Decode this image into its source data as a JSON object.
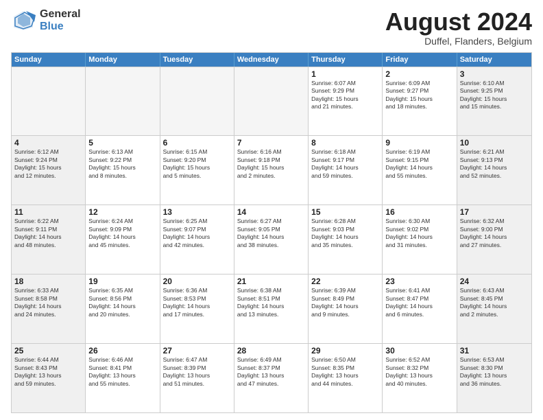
{
  "header": {
    "logo_general": "General",
    "logo_blue": "Blue",
    "month_title": "August 2024",
    "location": "Duffel, Flanders, Belgium"
  },
  "days_of_week": [
    "Sunday",
    "Monday",
    "Tuesday",
    "Wednesday",
    "Thursday",
    "Friday",
    "Saturday"
  ],
  "weeks": [
    [
      {
        "day": "",
        "text": "",
        "empty": true
      },
      {
        "day": "",
        "text": "",
        "empty": true
      },
      {
        "day": "",
        "text": "",
        "empty": true
      },
      {
        "day": "",
        "text": "",
        "empty": true
      },
      {
        "day": "1",
        "text": "Sunrise: 6:07 AM\nSunset: 9:29 PM\nDaylight: 15 hours\nand 21 minutes."
      },
      {
        "day": "2",
        "text": "Sunrise: 6:09 AM\nSunset: 9:27 PM\nDaylight: 15 hours\nand 18 minutes."
      },
      {
        "day": "3",
        "text": "Sunrise: 6:10 AM\nSunset: 9:25 PM\nDaylight: 15 hours\nand 15 minutes.",
        "shade": true
      }
    ],
    [
      {
        "day": "4",
        "text": "Sunrise: 6:12 AM\nSunset: 9:24 PM\nDaylight: 15 hours\nand 12 minutes.",
        "shade": true
      },
      {
        "day": "5",
        "text": "Sunrise: 6:13 AM\nSunset: 9:22 PM\nDaylight: 15 hours\nand 8 minutes."
      },
      {
        "day": "6",
        "text": "Sunrise: 6:15 AM\nSunset: 9:20 PM\nDaylight: 15 hours\nand 5 minutes."
      },
      {
        "day": "7",
        "text": "Sunrise: 6:16 AM\nSunset: 9:18 PM\nDaylight: 15 hours\nand 2 minutes."
      },
      {
        "day": "8",
        "text": "Sunrise: 6:18 AM\nSunset: 9:17 PM\nDaylight: 14 hours\nand 59 minutes."
      },
      {
        "day": "9",
        "text": "Sunrise: 6:19 AM\nSunset: 9:15 PM\nDaylight: 14 hours\nand 55 minutes."
      },
      {
        "day": "10",
        "text": "Sunrise: 6:21 AM\nSunset: 9:13 PM\nDaylight: 14 hours\nand 52 minutes.",
        "shade": true
      }
    ],
    [
      {
        "day": "11",
        "text": "Sunrise: 6:22 AM\nSunset: 9:11 PM\nDaylight: 14 hours\nand 48 minutes.",
        "shade": true
      },
      {
        "day": "12",
        "text": "Sunrise: 6:24 AM\nSunset: 9:09 PM\nDaylight: 14 hours\nand 45 minutes."
      },
      {
        "day": "13",
        "text": "Sunrise: 6:25 AM\nSunset: 9:07 PM\nDaylight: 14 hours\nand 42 minutes."
      },
      {
        "day": "14",
        "text": "Sunrise: 6:27 AM\nSunset: 9:05 PM\nDaylight: 14 hours\nand 38 minutes."
      },
      {
        "day": "15",
        "text": "Sunrise: 6:28 AM\nSunset: 9:03 PM\nDaylight: 14 hours\nand 35 minutes."
      },
      {
        "day": "16",
        "text": "Sunrise: 6:30 AM\nSunset: 9:02 PM\nDaylight: 14 hours\nand 31 minutes."
      },
      {
        "day": "17",
        "text": "Sunrise: 6:32 AM\nSunset: 9:00 PM\nDaylight: 14 hours\nand 27 minutes.",
        "shade": true
      }
    ],
    [
      {
        "day": "18",
        "text": "Sunrise: 6:33 AM\nSunset: 8:58 PM\nDaylight: 14 hours\nand 24 minutes.",
        "shade": true
      },
      {
        "day": "19",
        "text": "Sunrise: 6:35 AM\nSunset: 8:56 PM\nDaylight: 14 hours\nand 20 minutes."
      },
      {
        "day": "20",
        "text": "Sunrise: 6:36 AM\nSunset: 8:53 PM\nDaylight: 14 hours\nand 17 minutes."
      },
      {
        "day": "21",
        "text": "Sunrise: 6:38 AM\nSunset: 8:51 PM\nDaylight: 14 hours\nand 13 minutes."
      },
      {
        "day": "22",
        "text": "Sunrise: 6:39 AM\nSunset: 8:49 PM\nDaylight: 14 hours\nand 9 minutes."
      },
      {
        "day": "23",
        "text": "Sunrise: 6:41 AM\nSunset: 8:47 PM\nDaylight: 14 hours\nand 6 minutes."
      },
      {
        "day": "24",
        "text": "Sunrise: 6:43 AM\nSunset: 8:45 PM\nDaylight: 14 hours\nand 2 minutes.",
        "shade": true
      }
    ],
    [
      {
        "day": "25",
        "text": "Sunrise: 6:44 AM\nSunset: 8:43 PM\nDaylight: 13 hours\nand 59 minutes.",
        "shade": true
      },
      {
        "day": "26",
        "text": "Sunrise: 6:46 AM\nSunset: 8:41 PM\nDaylight: 13 hours\nand 55 minutes."
      },
      {
        "day": "27",
        "text": "Sunrise: 6:47 AM\nSunset: 8:39 PM\nDaylight: 13 hours\nand 51 minutes."
      },
      {
        "day": "28",
        "text": "Sunrise: 6:49 AM\nSunset: 8:37 PM\nDaylight: 13 hours\nand 47 minutes."
      },
      {
        "day": "29",
        "text": "Sunrise: 6:50 AM\nSunset: 8:35 PM\nDaylight: 13 hours\nand 44 minutes."
      },
      {
        "day": "30",
        "text": "Sunrise: 6:52 AM\nSunset: 8:32 PM\nDaylight: 13 hours\nand 40 minutes."
      },
      {
        "day": "31",
        "text": "Sunrise: 6:53 AM\nSunset: 8:30 PM\nDaylight: 13 hours\nand 36 minutes.",
        "shade": true
      }
    ]
  ]
}
